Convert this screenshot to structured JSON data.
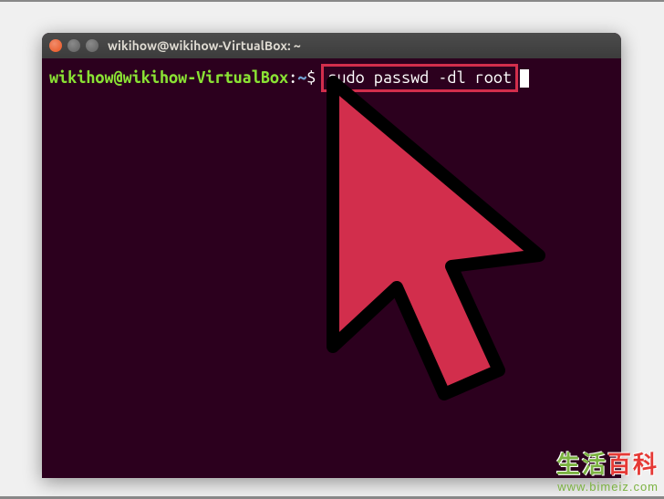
{
  "window": {
    "title": "wikihow@wikihow-VirtualBox: ~"
  },
  "terminal": {
    "prompt_user": "wikihow@wikihow-VirtualBox",
    "prompt_sep": ":",
    "prompt_path": "~",
    "prompt_dollar": "$",
    "command": "sudo passwd -dl root"
  },
  "watermark": {
    "text1": "生活",
    "text2": "百科",
    "url": "www.bimeiz.com"
  },
  "colors": {
    "terminal_bg": "#2c001e",
    "prompt_green": "#8ae234",
    "prompt_blue": "#729fcf",
    "highlight_box": "#d22e4c",
    "cursor_fill": "#d22e4c",
    "titlebar": "#3c3c3c",
    "close_orange": "#e95420"
  }
}
